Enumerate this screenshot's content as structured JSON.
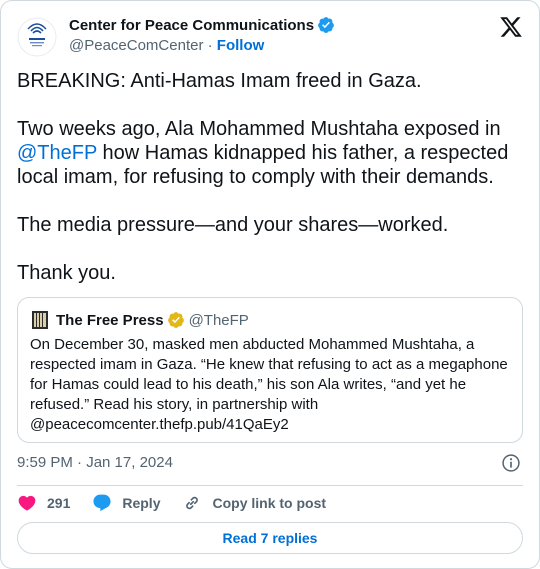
{
  "tweet": {
    "author_name": "Center for Peace Communications",
    "author_handle": "@PeaceComCenter",
    "separator": " · ",
    "follow_label": "Follow",
    "text_p1": "BREAKING: Anti-Hamas Imam freed in Gaza.",
    "text_p2_pre": "Two weeks ago, Ala Mohammed Mushtaha exposed in ",
    "text_p2_mention": "@TheFP",
    "text_p2_post": " how Hamas kidnapped his father, a respected local imam, for refusing to comply with their demands.",
    "text_p3": "The media pressure—and your shares—worked.",
    "text_p4": "Thank you.",
    "timestamp": "9:59 PM · Jan 17, 2024"
  },
  "quote": {
    "name": "The Free Press",
    "handle": "@TheFP",
    "text": "On December 30, masked men abducted Mohammed Mushtaha, a respected imam in Gaza. “He knew that refusing to act as a megaphone for Hamas could lead to his death,” his son Ala writes, “and yet he refused.” Read his story, in partnership with @peacecomcenter.thefp.pub/41QaEy2"
  },
  "actions": {
    "like_count": "291",
    "reply_label": "Reply",
    "copy_label": "Copy link to post"
  },
  "footer": {
    "read_replies_label": "Read 7 replies"
  },
  "icons": {
    "heart": "heart-icon",
    "reply": "reply-bubble-icon",
    "copy": "link-icon",
    "info": "info-icon",
    "x": "x-logo-icon",
    "verified": "verified-badge-icon"
  },
  "colors": {
    "accent": "#006fd6",
    "heart": "#f91880",
    "verified_blue": "#1d9bf0",
    "verified_gold": "#e2b719",
    "muted": "#536471",
    "border": "#cfd9de"
  }
}
